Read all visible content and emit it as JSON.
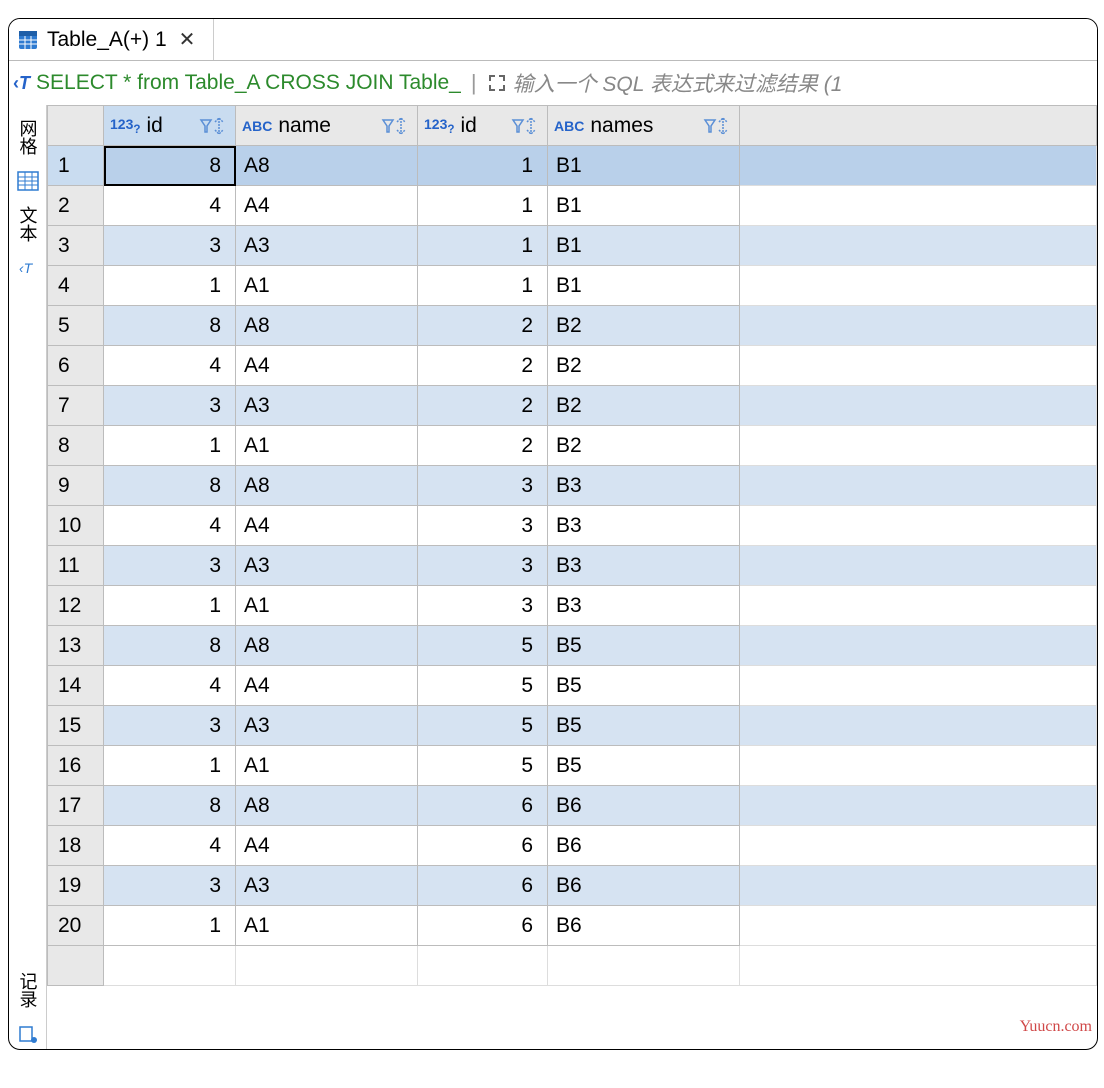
{
  "tab": {
    "title": "Table_A(+) 1"
  },
  "query": {
    "text": "SELECT * from Table_A CROSS JOIN Table_"
  },
  "filter": {
    "placeholder": "输入一个 SQL 表达式来过滤结果 (1"
  },
  "sidetabs": {
    "grid": "网格",
    "text": "文本",
    "record": "记录"
  },
  "columns": [
    {
      "type": "123",
      "label": "id"
    },
    {
      "type": "ABC",
      "label": "name"
    },
    {
      "type": "123",
      "label": "id"
    },
    {
      "type": "ABC",
      "label": "names"
    }
  ],
  "rows": [
    {
      "n": "1",
      "id1": "8",
      "name": "A8",
      "id2": "1",
      "names": "B1"
    },
    {
      "n": "2",
      "id1": "4",
      "name": "A4",
      "id2": "1",
      "names": "B1"
    },
    {
      "n": "3",
      "id1": "3",
      "name": "A3",
      "id2": "1",
      "names": "B1"
    },
    {
      "n": "4",
      "id1": "1",
      "name": "A1",
      "id2": "1",
      "names": "B1"
    },
    {
      "n": "5",
      "id1": "8",
      "name": "A8",
      "id2": "2",
      "names": "B2"
    },
    {
      "n": "6",
      "id1": "4",
      "name": "A4",
      "id2": "2",
      "names": "B2"
    },
    {
      "n": "7",
      "id1": "3",
      "name": "A3",
      "id2": "2",
      "names": "B2"
    },
    {
      "n": "8",
      "id1": "1",
      "name": "A1",
      "id2": "2",
      "names": "B2"
    },
    {
      "n": "9",
      "id1": "8",
      "name": "A8",
      "id2": "3",
      "names": "B3"
    },
    {
      "n": "10",
      "id1": "4",
      "name": "A4",
      "id2": "3",
      "names": "B3"
    },
    {
      "n": "11",
      "id1": "3",
      "name": "A3",
      "id2": "3",
      "names": "B3"
    },
    {
      "n": "12",
      "id1": "1",
      "name": "A1",
      "id2": "3",
      "names": "B3"
    },
    {
      "n": "13",
      "id1": "8",
      "name": "A8",
      "id2": "5",
      "names": "B5"
    },
    {
      "n": "14",
      "id1": "4",
      "name": "A4",
      "id2": "5",
      "names": "B5"
    },
    {
      "n": "15",
      "id1": "3",
      "name": "A3",
      "id2": "5",
      "names": "B5"
    },
    {
      "n": "16",
      "id1": "1",
      "name": "A1",
      "id2": "5",
      "names": "B5"
    },
    {
      "n": "17",
      "id1": "8",
      "name": "A8",
      "id2": "6",
      "names": "B6"
    },
    {
      "n": "18",
      "id1": "4",
      "name": "A4",
      "id2": "6",
      "names": "B6"
    },
    {
      "n": "19",
      "id1": "3",
      "name": "A3",
      "id2": "6",
      "names": "B6"
    },
    {
      "n": "20",
      "id1": "1",
      "name": "A1",
      "id2": "6",
      "names": "B6"
    }
  ],
  "watermark": "Yuucn.com"
}
